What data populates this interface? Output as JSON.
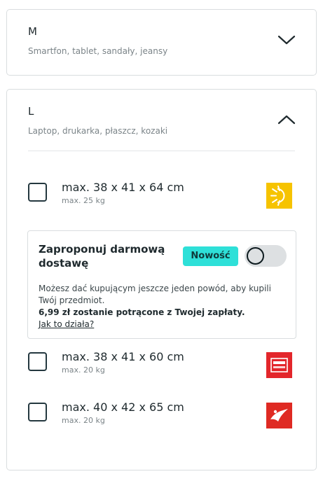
{
  "size_m": {
    "letter": "M",
    "description": "Smartfon, tablet, sandały, jeansy",
    "expanded": false
  },
  "size_l": {
    "letter": "L",
    "description": "Laptop, drukarka, płaszcz, kozaki",
    "expanded": true,
    "options": [
      {
        "dimensions": "max. 38 x 41 x 64 cm",
        "weight": "max. 25 kg",
        "carrier_icon": "sun-locker-icon",
        "carrier_color": "#f6c300",
        "checked": false
      },
      {
        "dimensions": "max. 38 x 41 x 60 cm",
        "weight": "max. 20 kg",
        "carrier_icon": "orlen-paczka-icon",
        "carrier_color": "#e3262b",
        "checked": false
      },
      {
        "dimensions": "max. 40 x 42 x 65 cm",
        "weight": "max. 20 kg",
        "carrier_icon": "bird-carrier-icon",
        "carrier_color": "#df2a23",
        "checked": false
      }
    ],
    "free_shipping": {
      "title": "Zaproponuj darmową dostawę",
      "badge": "Nowość",
      "toggle_on": false,
      "text": "Możesz dać kupującym jeszcze jeden powód, aby kupili Twój przedmiot.",
      "bold_text": "6,99 zł zostanie potrącone z Twojej zapłaty.",
      "link": "Jak to działa?"
    }
  }
}
